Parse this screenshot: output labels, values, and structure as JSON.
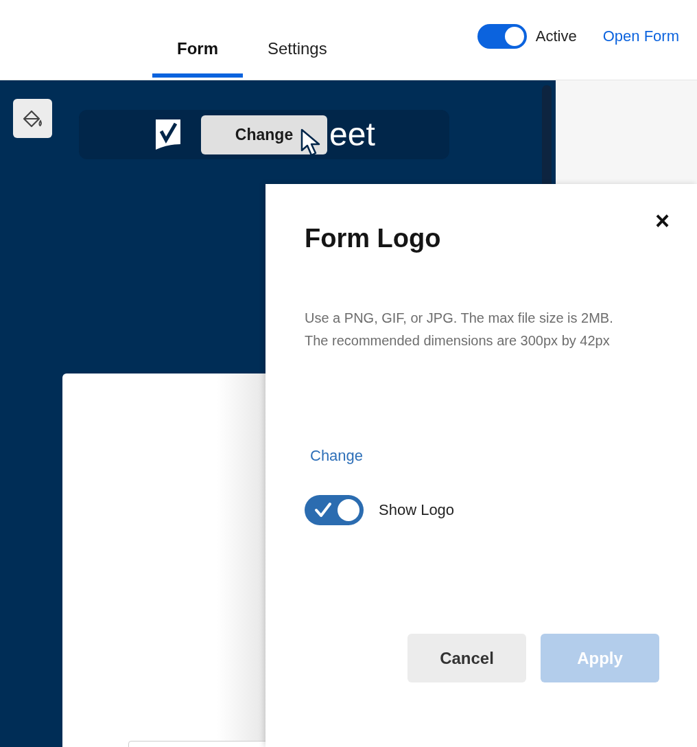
{
  "tabs": [
    {
      "label": "Form",
      "selected": true
    },
    {
      "label": "Settings",
      "selected": false
    }
  ],
  "active_toggle": {
    "label": "Active",
    "on": true
  },
  "open_form_link": "Open Form",
  "logo": {
    "text_after": "eet",
    "change_button": "Change"
  },
  "dialog": {
    "title": "Form Logo",
    "close": "×",
    "description": "Use a PNG, GIF, or JPG. The max file size is 2MB. The recommended dimensions are 300px by 42px",
    "change_link": "Change",
    "show_logo": {
      "label": "Show Logo",
      "on": true
    },
    "buttons": [
      {
        "label": "Cancel",
        "disabled": false,
        "kind": "secondary"
      },
      {
        "label": "Apply",
        "disabled": true,
        "kind": "primary"
      }
    ]
  }
}
